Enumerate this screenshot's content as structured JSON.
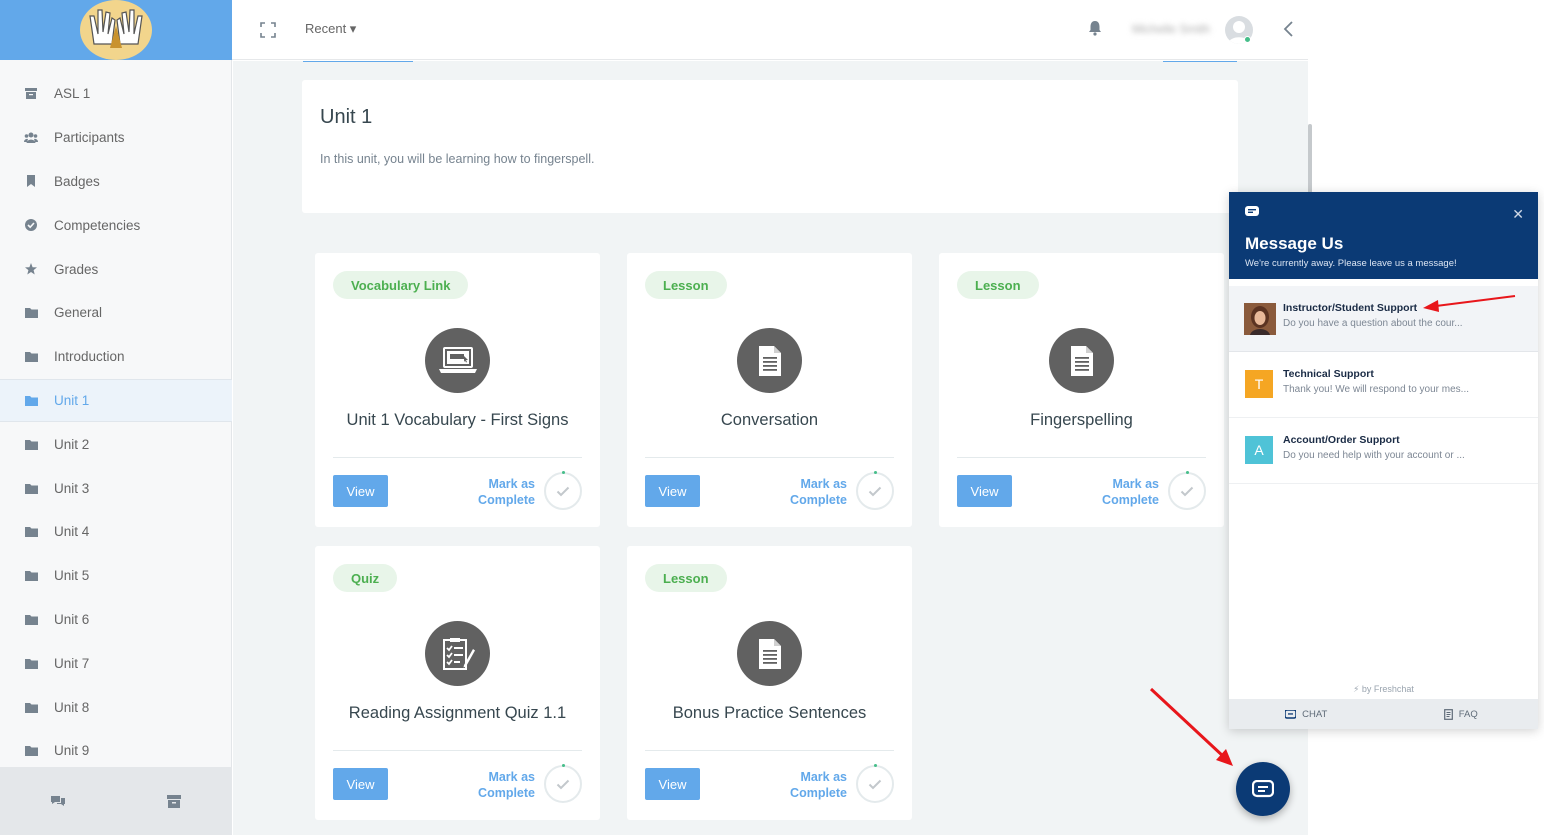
{
  "topbar": {
    "recent_label": "Recent ▾",
    "username": "Michelle Smith"
  },
  "sidebar": {
    "items": [
      {
        "label": "ASL 1",
        "icon": "archive-icon"
      },
      {
        "label": "Participants",
        "icon": "users-icon"
      },
      {
        "label": "Badges",
        "icon": "bookmark-icon"
      },
      {
        "label": "Competencies",
        "icon": "check-circle-icon"
      },
      {
        "label": "Grades",
        "icon": "star-icon"
      },
      {
        "label": "General",
        "icon": "folder-icon"
      },
      {
        "label": "Introduction",
        "icon": "folder-icon"
      },
      {
        "label": "Unit 1",
        "icon": "folder-icon",
        "active": true
      },
      {
        "label": "Unit 2",
        "icon": "folder-icon"
      },
      {
        "label": "Unit 3",
        "icon": "folder-icon"
      },
      {
        "label": "Unit 4",
        "icon": "folder-icon"
      },
      {
        "label": "Unit 5",
        "icon": "folder-icon"
      },
      {
        "label": "Unit 6",
        "icon": "folder-icon"
      },
      {
        "label": "Unit 7",
        "icon": "folder-icon"
      },
      {
        "label": "Unit 8",
        "icon": "folder-icon"
      },
      {
        "label": "Unit 9",
        "icon": "folder-icon"
      }
    ]
  },
  "unit": {
    "title": "Unit 1",
    "description": "In this unit, you will be learning how to fingerspell."
  },
  "activities": [
    {
      "badge": "Vocabulary Link",
      "title": "Unit 1 Vocabulary - First Signs",
      "icon": "laptop-icon",
      "view": "View",
      "mark1": "Mark as",
      "mark2": "Complete"
    },
    {
      "badge": "Lesson",
      "title": "Conversation",
      "icon": "document-icon",
      "view": "View",
      "mark1": "Mark as",
      "mark2": "Complete"
    },
    {
      "badge": "Lesson",
      "title": "Fingerspelling",
      "icon": "document-icon",
      "view": "View",
      "mark1": "Mark as",
      "mark2": "Complete"
    },
    {
      "badge": "Quiz",
      "title": "Reading Assignment Quiz 1.1",
      "icon": "quiz-icon",
      "view": "View",
      "mark1": "Mark as",
      "mark2": "Complete"
    },
    {
      "badge": "Lesson",
      "title": "Bonus Practice Sentences",
      "icon": "document-icon",
      "view": "View",
      "mark1": "Mark as",
      "mark2": "Complete"
    }
  ],
  "chat": {
    "title": "Message Us",
    "subtitle": "We're currently away. Please leave us a message!",
    "channels": [
      {
        "name": "Instructor/Student Support",
        "desc": "Do you have a question about the cour...",
        "avatar": "",
        "color": ""
      },
      {
        "name": "Technical Support",
        "desc": "Thank you! We will respond to your mes...",
        "avatar": "T",
        "color": "#f5a623"
      },
      {
        "name": "Account/Order Support",
        "desc": "Do you need help with your account or ...",
        "avatar": "A",
        "color": "#4fc3d7"
      }
    ],
    "powered": "by Freshchat",
    "tab_chat": "CHAT",
    "tab_faq": "FAQ"
  },
  "colors": {
    "primary": "#62a8ea",
    "badge_green": "#4caf50",
    "chat_navy": "#0b3a75",
    "arrow_red": "#e8161b"
  }
}
